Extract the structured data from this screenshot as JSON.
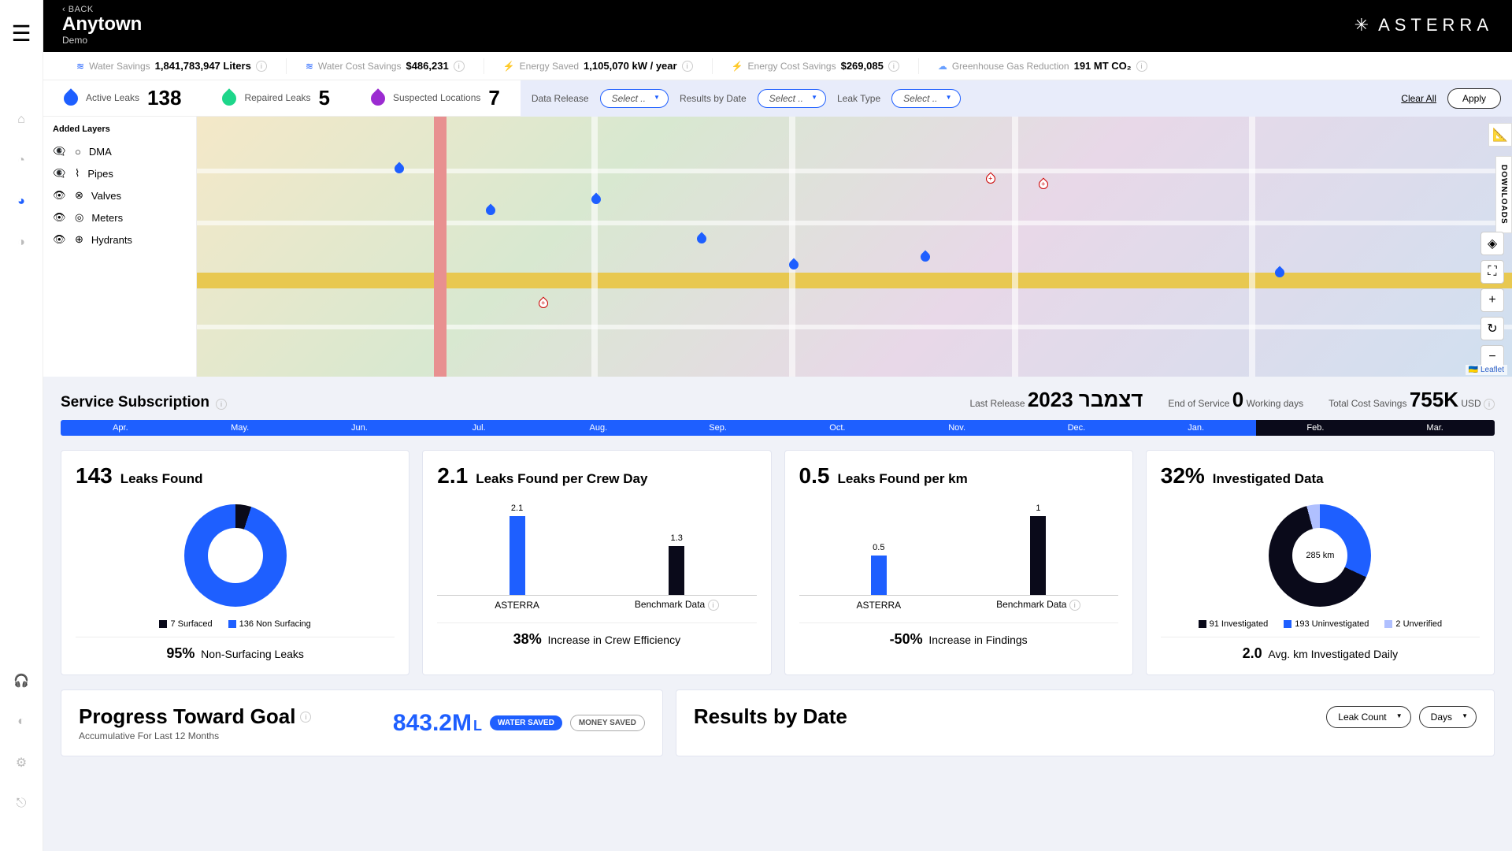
{
  "header": {
    "back": "BACK",
    "title": "Anytown",
    "subtitle": "Demo",
    "brand": "ASTERRA"
  },
  "toolbar": [
    {
      "label": "Water Savings",
      "value": "1,841,783,947 Liters"
    },
    {
      "label": "Water Cost Savings",
      "value": "$486,231"
    },
    {
      "label": "Energy Saved",
      "value": "1,105,070 kW / year"
    },
    {
      "label": "Energy Cost Savings",
      "value": "$269,085"
    },
    {
      "label": "Greenhouse Gas Reduction",
      "value": "191 MT CO₂"
    }
  ],
  "stats": {
    "active": {
      "label": "Active Leaks",
      "value": "138"
    },
    "repaired": {
      "label": "Repaired Leaks",
      "value": "5"
    },
    "suspected": {
      "label": "Suspected Locations",
      "value": "7"
    }
  },
  "filters": {
    "data_release": "Data Release",
    "results_by_date": "Results by Date",
    "leak_type": "Leak Type",
    "select_placeholder": "Select ..",
    "clear": "Clear All",
    "apply": "Apply"
  },
  "layers": {
    "title": "Added Layers",
    "items": [
      "DMA",
      "Pipes",
      "Valves",
      "Meters",
      "Hydrants"
    ]
  },
  "map": {
    "attribution": "Leaflet",
    "downloads": "DOWNLOADS"
  },
  "subscription": {
    "title": "Service Subscription",
    "last_release_label": "Last Release",
    "last_release_value": "דצמבר 2023",
    "end_label": "End of Service",
    "end_value": "0",
    "end_unit": "Working days",
    "savings_label": "Total Cost Savings",
    "savings_value": "755K",
    "savings_cur": "USD"
  },
  "timeline": [
    "Apr.",
    "May.",
    "Jun.",
    "Jul.",
    "Aug.",
    "Sep.",
    "Oct.",
    "Nov.",
    "Dec.",
    "Jan.",
    "Feb.",
    "Mar."
  ],
  "cards": {
    "leaks_found": {
      "value": "143",
      "label": "Leaks Found",
      "legend": [
        {
          "color": "#0a0a1a",
          "text": "7 Surfaced"
        },
        {
          "color": "#1e5fff",
          "text": "136 Non Surfacing"
        }
      ],
      "foot_pct": "95%",
      "foot_text": "Non-Surfacing Leaks"
    },
    "per_crew": {
      "value": "2.1",
      "label": "Leaks Found per Crew Day",
      "categories": [
        "ASTERRA",
        "Benchmark Data"
      ],
      "values": [
        2.1,
        1.3
      ],
      "foot_pct": "38%",
      "foot_text": "Increase in Crew Efficiency"
    },
    "per_km": {
      "value": "0.5",
      "label": "Leaks Found per km",
      "categories": [
        "ASTERRA",
        "Benchmark Data"
      ],
      "values": [
        0.5,
        1
      ],
      "foot_pct": "-50%",
      "foot_text": "Increase in Findings"
    },
    "investigated": {
      "value": "32%",
      "label": "Investigated Data",
      "center": "285 km",
      "legend": [
        {
          "color": "#0a0a1a",
          "text": "91 Investigated"
        },
        {
          "color": "#1e5fff",
          "text": "193 Uninvestigated"
        },
        {
          "color": "#b0c0ff",
          "text": "2 Unverified"
        }
      ],
      "foot_pct": "2.0",
      "foot_text": "Avg. km Investigated Daily"
    }
  },
  "progress": {
    "title": "Progress Toward Goal",
    "subtitle": "Accumulative For Last 12 Months",
    "value": "843.2M",
    "unit": "L",
    "pill_active": "WATER SAVED",
    "pill_inactive": "MONEY SAVED"
  },
  "results": {
    "title": "Results by Date",
    "sel1": "Leak Count",
    "sel2": "Days"
  },
  "chart_data": [
    {
      "type": "pie",
      "title": "Leaks Found",
      "series": [
        {
          "name": "Surfaced",
          "value": 7
        },
        {
          "name": "Non Surfacing",
          "value": 136
        }
      ]
    },
    {
      "type": "bar",
      "title": "Leaks Found per Crew Day",
      "categories": [
        "ASTERRA",
        "Benchmark Data"
      ],
      "values": [
        2.1,
        1.3
      ],
      "ylim": [
        0,
        2.5
      ]
    },
    {
      "type": "bar",
      "title": "Leaks Found per km",
      "categories": [
        "ASTERRA",
        "Benchmark Data"
      ],
      "values": [
        0.5,
        1
      ],
      "ylim": [
        0,
        1.2
      ]
    },
    {
      "type": "pie",
      "title": "Investigated Data",
      "series": [
        {
          "name": "Investigated",
          "value": 91
        },
        {
          "name": "Uninvestigated",
          "value": 193
        },
        {
          "name": "Unverified",
          "value": 2
        }
      ]
    }
  ]
}
